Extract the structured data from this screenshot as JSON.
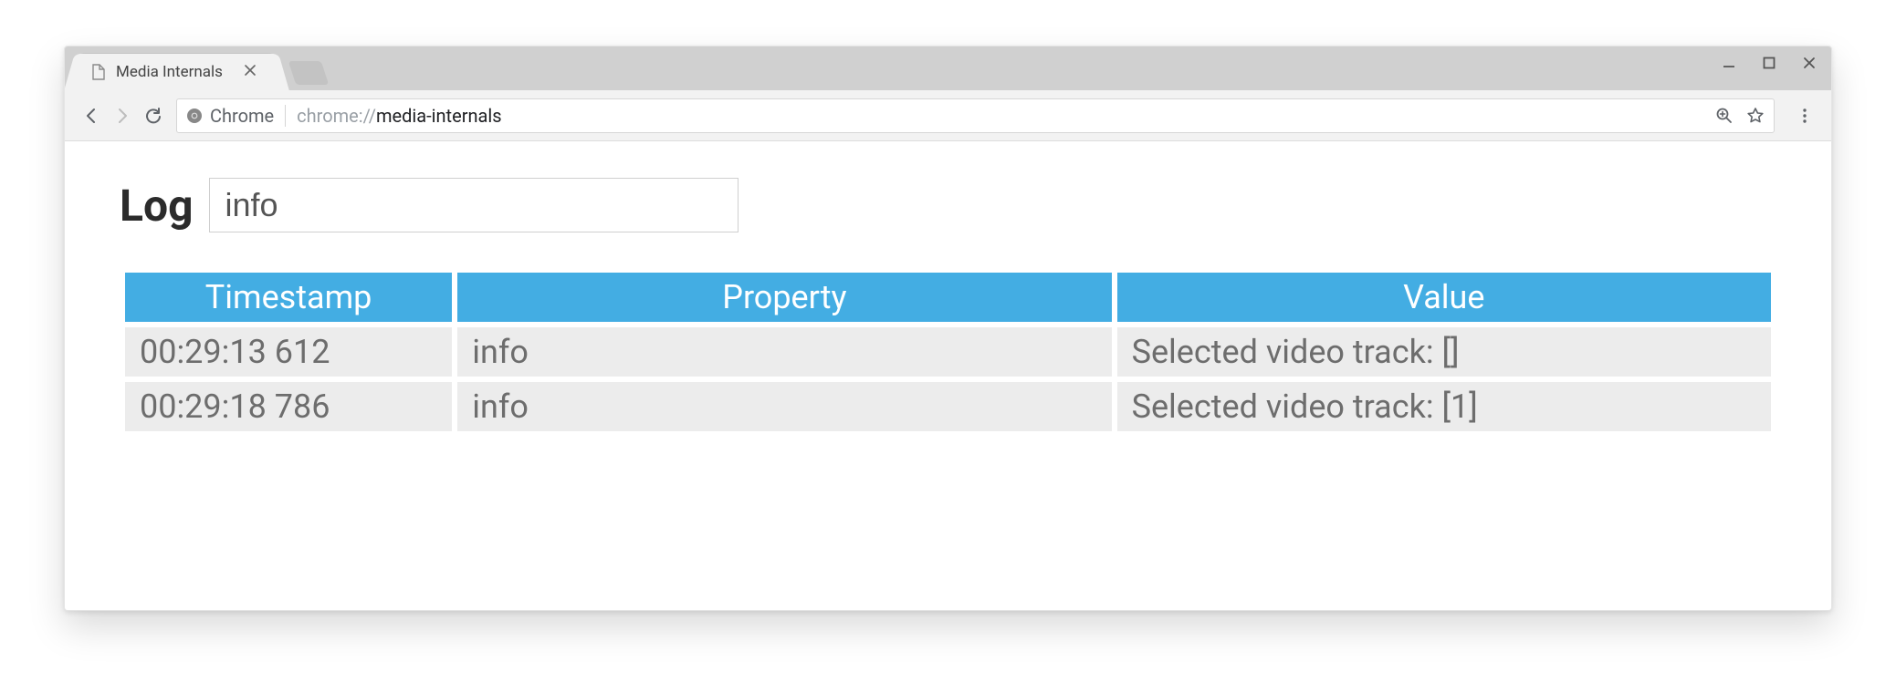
{
  "browser": {
    "tab_title": "Media Internals",
    "site_label": "Chrome",
    "url_scheme": "chrome://",
    "url_path": "media-internals"
  },
  "page": {
    "heading": "Log",
    "filter_value": "info",
    "columns": [
      "Timestamp",
      "Property",
      "Value"
    ],
    "rows": [
      {
        "timestamp": "00:29:13 612",
        "property": "info",
        "value": "Selected video track: []"
      },
      {
        "timestamp": "00:29:18 786",
        "property": "info",
        "value": "Selected video track: [1]"
      }
    ]
  }
}
